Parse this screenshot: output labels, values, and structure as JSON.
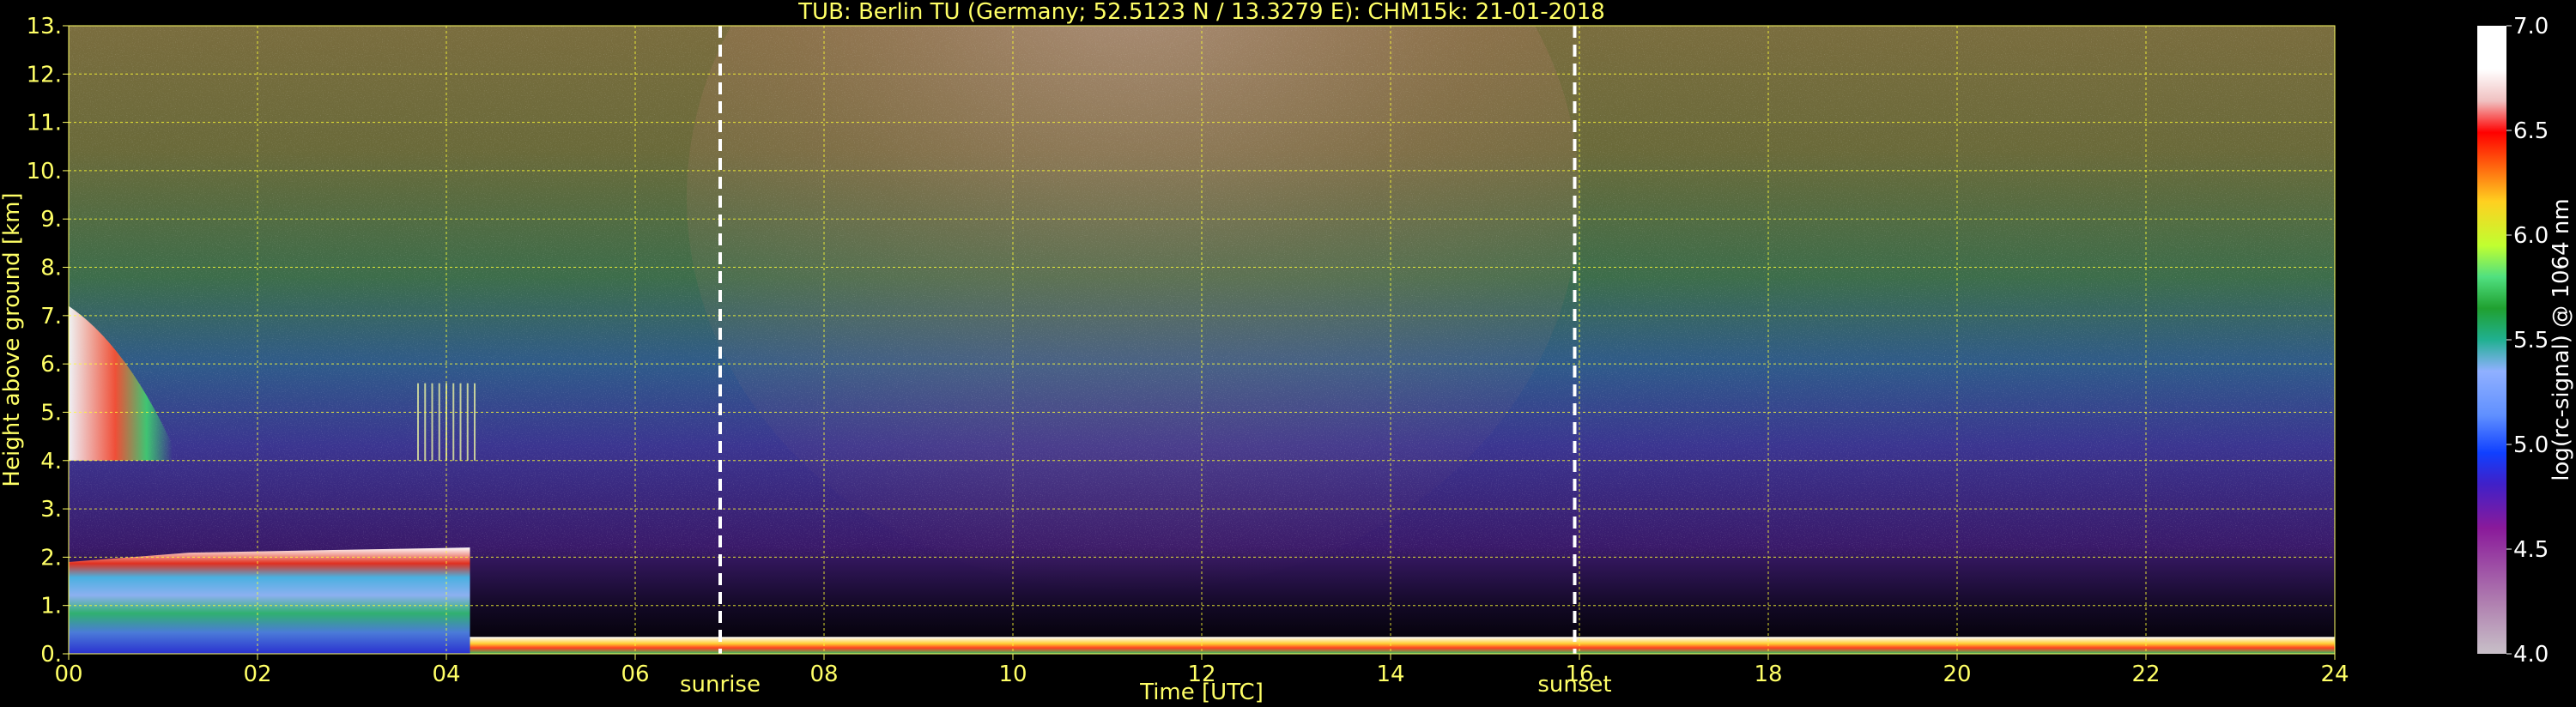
{
  "chart_data": {
    "type": "heatmap",
    "title": "TUB: Berlin TU (Germany; 52.5123 N / 13.3279 E):    CHM15k: 21-01-2018",
    "xlabel": "Time [UTC]",
    "ylabel": "Height above ground [km]",
    "xlim": [
      0,
      24
    ],
    "ylim": [
      0,
      13
    ],
    "x_ticks": [
      "00",
      "02",
      "04",
      "06",
      "08",
      "10",
      "12",
      "14",
      "16",
      "18",
      "20",
      "22",
      "24"
    ],
    "y_ticks": [
      "0.",
      "1.",
      "2.",
      "3.",
      "4.",
      "5.",
      "6.",
      "7.",
      "8.",
      "9.",
      "10.",
      "11.",
      "12.",
      "13."
    ],
    "grid": true,
    "colorbar": {
      "label": "log(rc-signal) @ 1064 nm",
      "range": [
        4.0,
        7.0
      ],
      "ticks": [
        "4.0",
        "4.5",
        "5.0",
        "5.5",
        "6.0",
        "6.5",
        "7.0"
      ]
    },
    "events": [
      {
        "label": "sunrise",
        "time": 6.9
      },
      {
        "label": "sunset",
        "time": 15.95
      }
    ],
    "features": [
      {
        "name": "aerosol boundary layer",
        "start": 0.0,
        "end": 4.25,
        "top_km": 2.2,
        "value": 5.0
      },
      {
        "name": "cloud layer",
        "start": 0.0,
        "end": 1.1,
        "base_km": 4.0,
        "top_km": 7.2,
        "value": 6.3
      },
      {
        "name": "cloud fallstreaks",
        "start": 3.7,
        "end": 4.3,
        "base_km": 4.0,
        "top_km": 5.6,
        "value": 5.3
      },
      {
        "name": "near-surface layer",
        "start": 4.25,
        "end": 24.0,
        "top_km": 0.35,
        "value": 6.5
      }
    ]
  }
}
